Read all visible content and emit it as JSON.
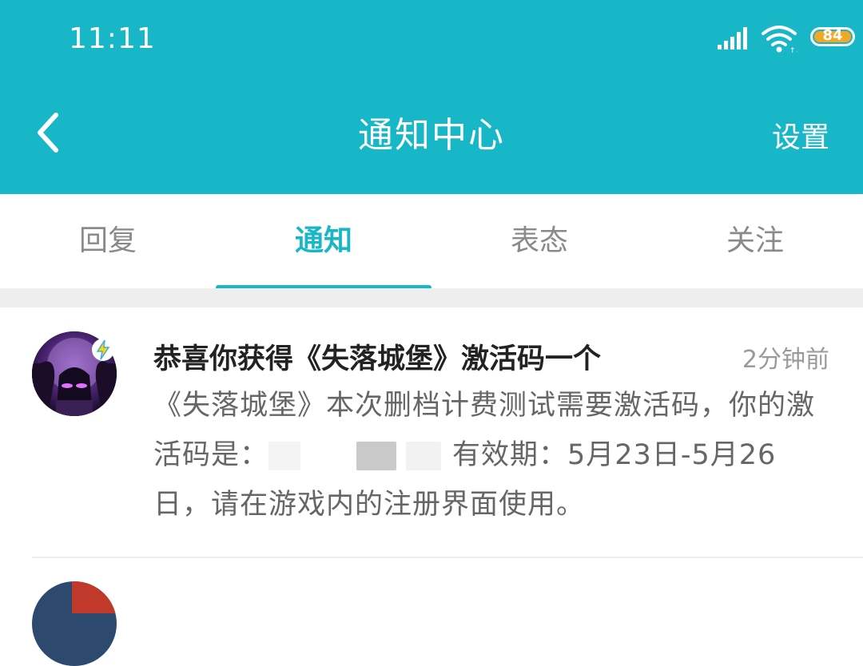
{
  "status_bar": {
    "time": "11:11",
    "battery_level": "84",
    "battery_color": "#f5a623",
    "icons": [
      "signal-icon",
      "wifi-icon",
      "battery-icon"
    ]
  },
  "nav": {
    "back_icon": "chevron-left-icon",
    "title": "通知中心",
    "settings_label": "设置",
    "background": "#17b7c8"
  },
  "tabs": {
    "items": [
      {
        "label": "回复"
      },
      {
        "label": "通知"
      },
      {
        "label": "表态"
      },
      {
        "label": "关注"
      }
    ],
    "active_index": 1,
    "active_color": "#17b7c8"
  },
  "notifications": [
    {
      "avatar": "game-avatar",
      "badge_icon": "lightning-icon",
      "title": "恭喜你获得《失落城堡》激活码一个",
      "time": "2分钟前",
      "body_part1": "《失落城堡》本次删档计费测试需要激活码，你的激活码是：",
      "body_part2": "有效期：5月23日-5月26日，请在游戏内的注册界面使用。"
    }
  ]
}
